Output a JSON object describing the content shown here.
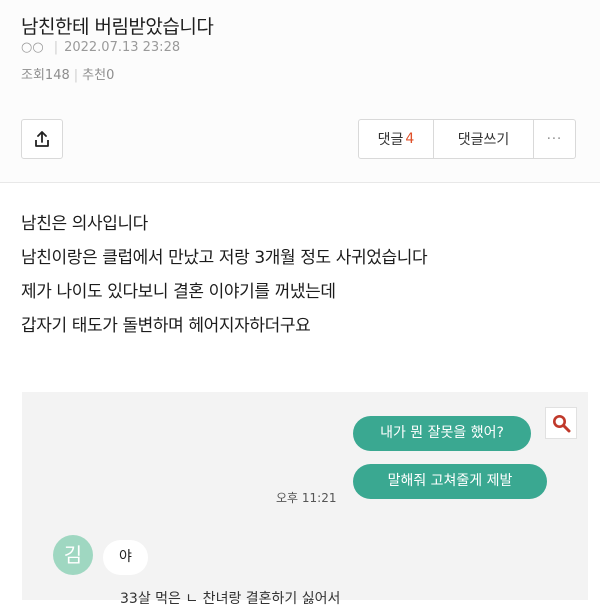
{
  "post": {
    "title": "남친한테 버림받았습니다",
    "author": "○○",
    "datetime": "2022.07.13 23:28",
    "views_label": "조회",
    "views": "148",
    "likes_label": "추천",
    "likes": "0"
  },
  "toolbar": {
    "comments_label": "댓글",
    "comments_count": "4",
    "write_label": "댓글쓰기",
    "more_label": "···"
  },
  "body": {
    "lines": [
      "남친은 의사입니다",
      "남친이랑은 클럽에서 만났고 저랑 3개월 정도 사귀었습니다",
      "제가 나이도 있다보니 결혼 이야기를 꺼냈는데",
      "갑자기 태도가 돌변하며 헤어지자하더구요"
    ]
  },
  "chat": {
    "outgoing": [
      "내가 뭔 잘못을 했어?",
      "말해줘 고쳐줄게 제발"
    ],
    "time": "오후 11:21",
    "avatar_letter": "김",
    "incoming": [
      "야"
    ],
    "cut_line": "33살 먹은 ㄴ 찬녀랑 결혼하기 싫어서"
  },
  "colors": {
    "bubble_green": "#3aa891",
    "comment_count": "#e0512a",
    "avatar": "#9fd7c1"
  },
  "icons": [
    "share-icon",
    "search-icon",
    "more-icon"
  ]
}
